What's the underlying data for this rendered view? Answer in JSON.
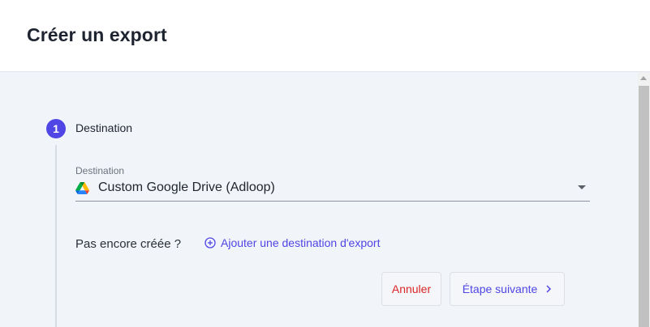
{
  "dialog": {
    "title": "Créer un export"
  },
  "step": {
    "number": "1",
    "title": "Destination"
  },
  "destination_field": {
    "label": "Destination",
    "value": "Custom Google Drive (Adloop)",
    "icon": "google-drive-icon"
  },
  "not_created": {
    "text": "Pas encore créée ?",
    "link_label": "Ajouter une destination d'export",
    "link_icon": "plus-circle-icon"
  },
  "actions": {
    "cancel_label": "Annuler",
    "next_label": "Étape suivante",
    "next_icon": "chevron-right-icon"
  },
  "colors": {
    "accent": "#4f46e5",
    "danger": "#d92626",
    "body_bg": "#f1f4f8"
  }
}
